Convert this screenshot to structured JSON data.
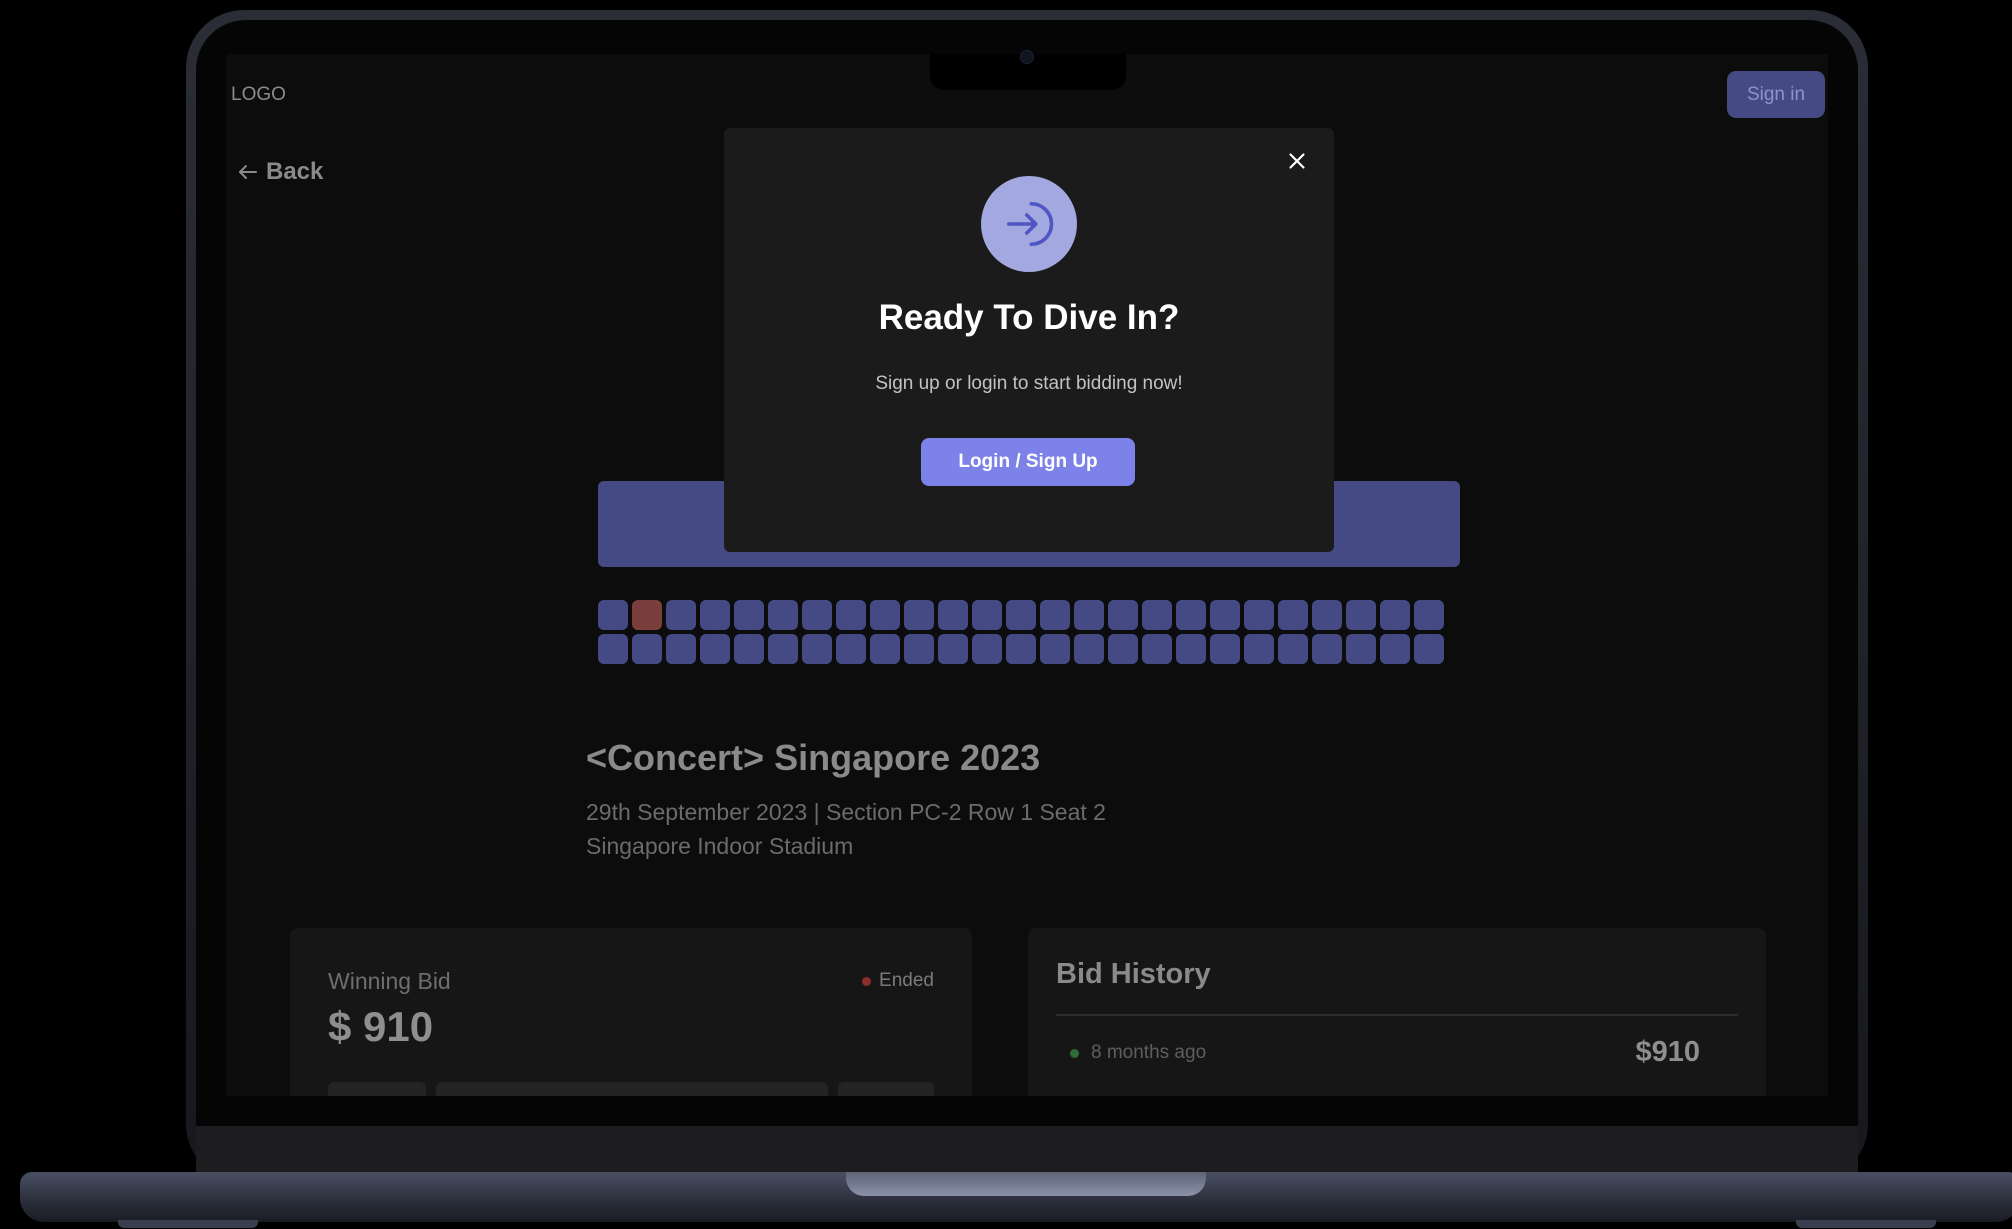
{
  "header": {
    "logo": "LOGO",
    "signin_label": "Sign in"
  },
  "nav": {
    "back_label": "Back"
  },
  "seat_map": {
    "rows": 2,
    "seats_per_row": 25,
    "highlighted_seat": {
      "row": 1,
      "seat": 2
    },
    "colors": {
      "available": "#454a85",
      "highlighted": "#7a3f3c",
      "stage": "#454a85"
    }
  },
  "event": {
    "title": "<Concert> Singapore 2023",
    "details": "29th September 2023 | Section PC-2 Row 1 Seat 2",
    "venue": "Singapore Indoor Stadium"
  },
  "bid": {
    "label": "Winning Bid",
    "amount": "$ 910",
    "status": "Ended"
  },
  "history": {
    "title": "Bid History",
    "entries": [
      {
        "time": "8 months ago",
        "amount": "$910"
      }
    ]
  },
  "modal": {
    "title": "Ready To Dive In?",
    "subtitle": "Sign up or login to start bidding now!",
    "cta_label": "Login / Sign Up",
    "icon": "login-arrow-icon",
    "accent": "#7c82e8"
  }
}
